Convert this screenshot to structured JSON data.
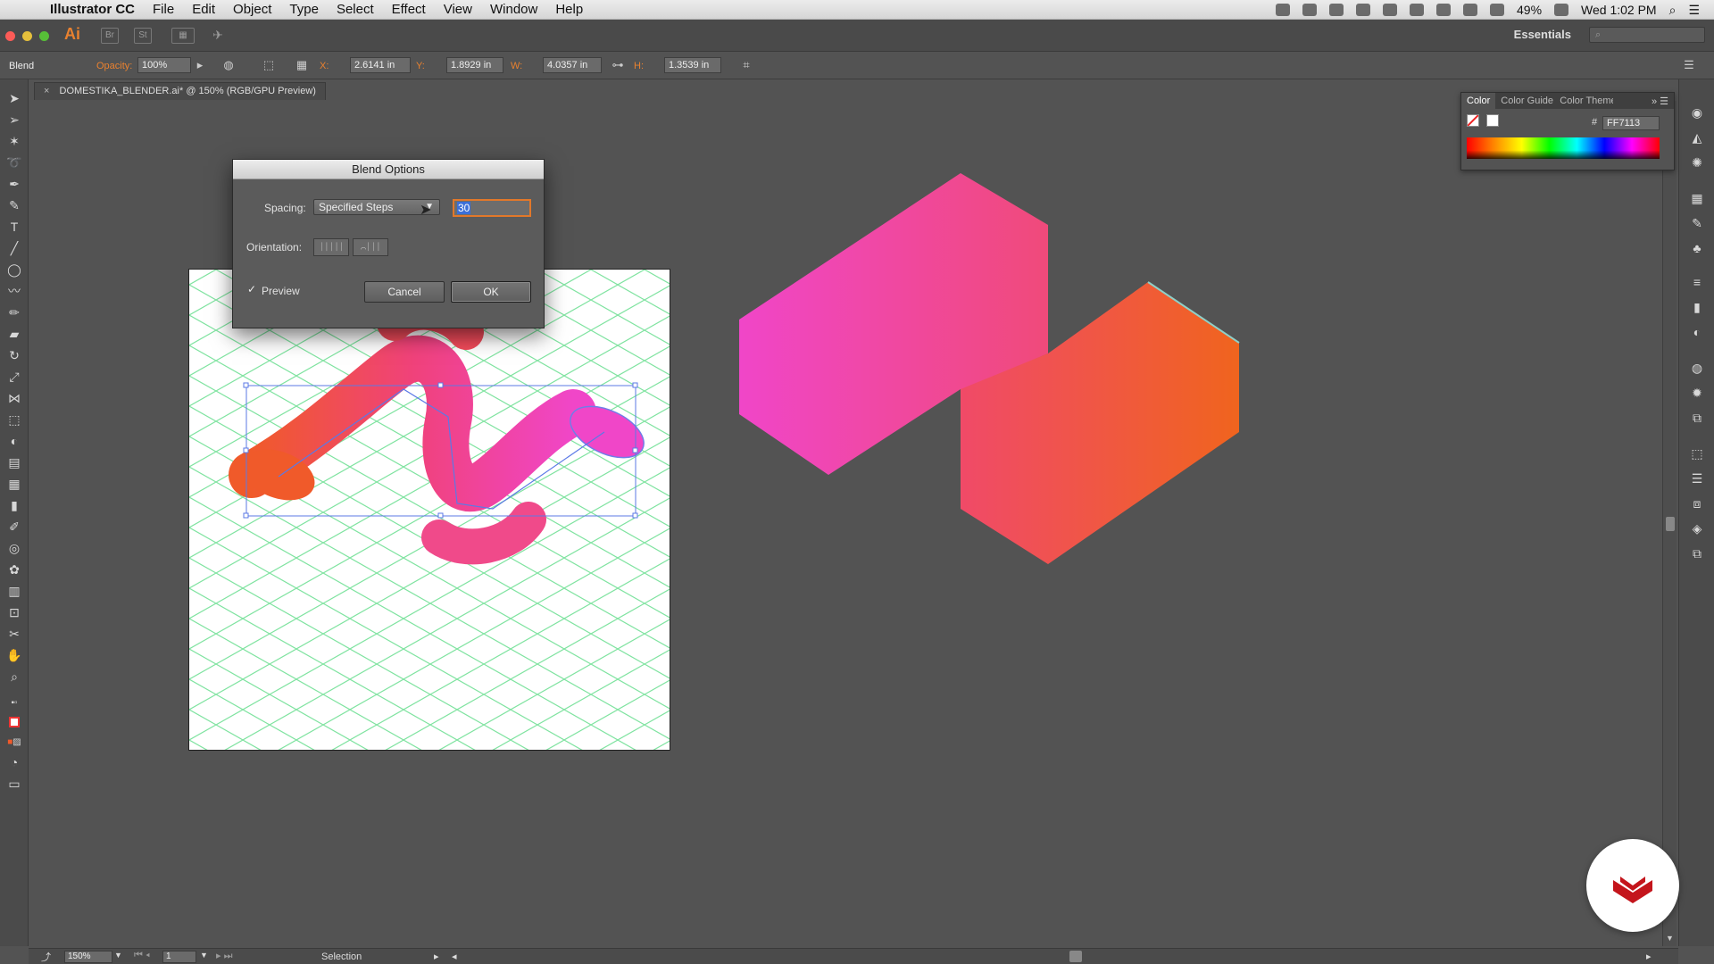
{
  "menubar": {
    "app_name": "Illustrator CC",
    "menus": [
      "File",
      "Edit",
      "Object",
      "Type",
      "Select",
      "Effect",
      "View",
      "Window",
      "Help"
    ],
    "battery": "49%",
    "clock": "Wed 1:02 PM"
  },
  "appbar": {
    "logo": "Ai",
    "br": "Br",
    "st": "St",
    "workspace": "Essentials"
  },
  "controlbar": {
    "mode": "Blend",
    "opacity_label": "Opacity:",
    "opacity_value": "100%",
    "x_label": "X:",
    "x_value": "2.6141 in",
    "y_label": "Y:",
    "y_value": "1.8929 in",
    "w_label": "W:",
    "w_value": "4.0357 in",
    "h_label": "H:",
    "h_value": "1.3539 in"
  },
  "document": {
    "tab_title": "DOMESTIKA_BLENDER.ai* @ 150% (RGB/GPU Preview)"
  },
  "dialog": {
    "title": "Blend Options",
    "spacing_label": "Spacing:",
    "spacing_value": "Specified Steps",
    "steps_value": "30",
    "orientation_label": "Orientation:",
    "preview_label": "Preview",
    "preview_checked": true,
    "cancel_label": "Cancel",
    "ok_label": "OK"
  },
  "color_panel": {
    "tabs": [
      "Color",
      "Color Guide",
      "Color Themes"
    ],
    "hex_prefix": "#",
    "hex_value": "FF7113"
  },
  "statusbar": {
    "zoom": "150%",
    "artboard": "1",
    "tool": "Selection"
  },
  "colors": {
    "accent_orange": "#e9812f",
    "shape_orange": "#f05a2a",
    "shape_pink": "#f03c8e",
    "shape_magenta": "#f046c8",
    "grid_green": "#7fe3a0"
  }
}
